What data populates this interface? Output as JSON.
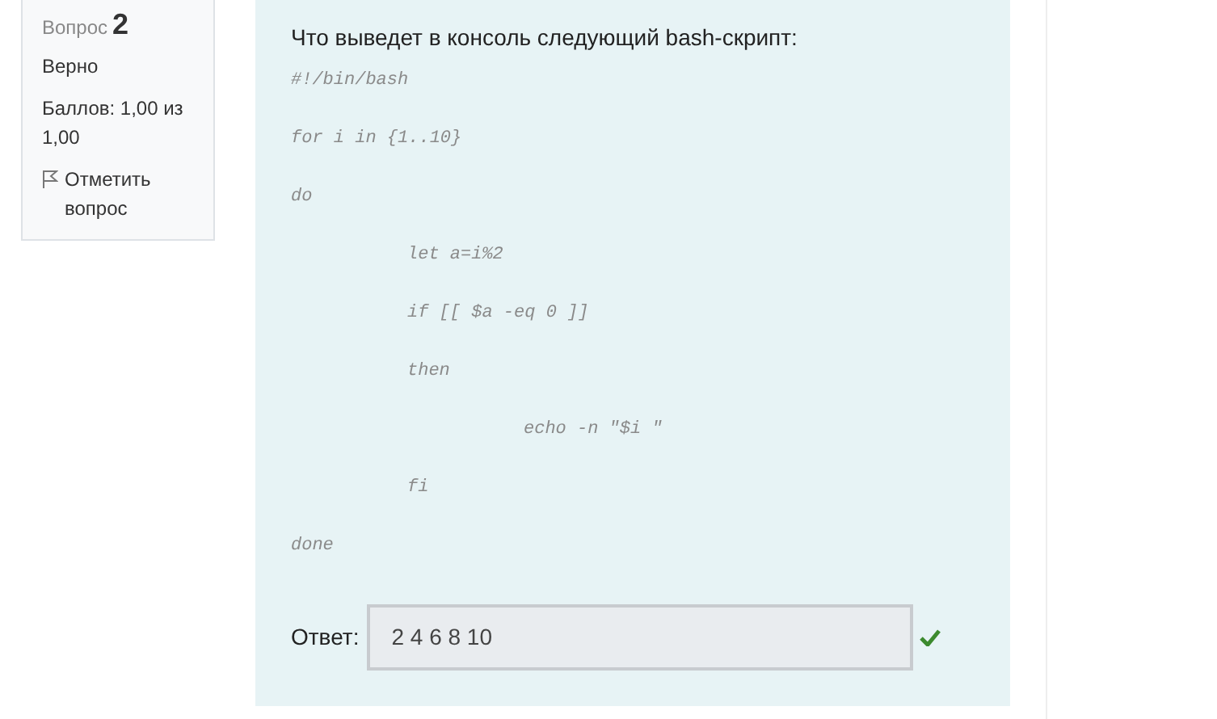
{
  "info": {
    "label": "Вопрос",
    "number": "2",
    "state": "Верно",
    "grade": "Баллов: 1,00 из 1,00",
    "flag": "Отметить вопрос"
  },
  "question": {
    "text": "Что выведет в консоль следующий bash-скрипт:",
    "code": [
      {
        "text": "#!/bin/bash"
      },
      {
        "text": "for i in {1..10}"
      },
      {
        "text": "do",
        "children": [
          {
            "text": "let a=i%2"
          },
          {
            "text": "if [[ $a -eq 0 ]]"
          },
          {
            "text": "then",
            "children": [
              {
                "text": "echo -n \"$i \""
              }
            ]
          },
          {
            "text": "fi"
          }
        ]
      },
      {
        "text": "done"
      }
    ]
  },
  "answer": {
    "label": "Ответ:",
    "value": "2 4 6 8 10",
    "correct": true
  }
}
